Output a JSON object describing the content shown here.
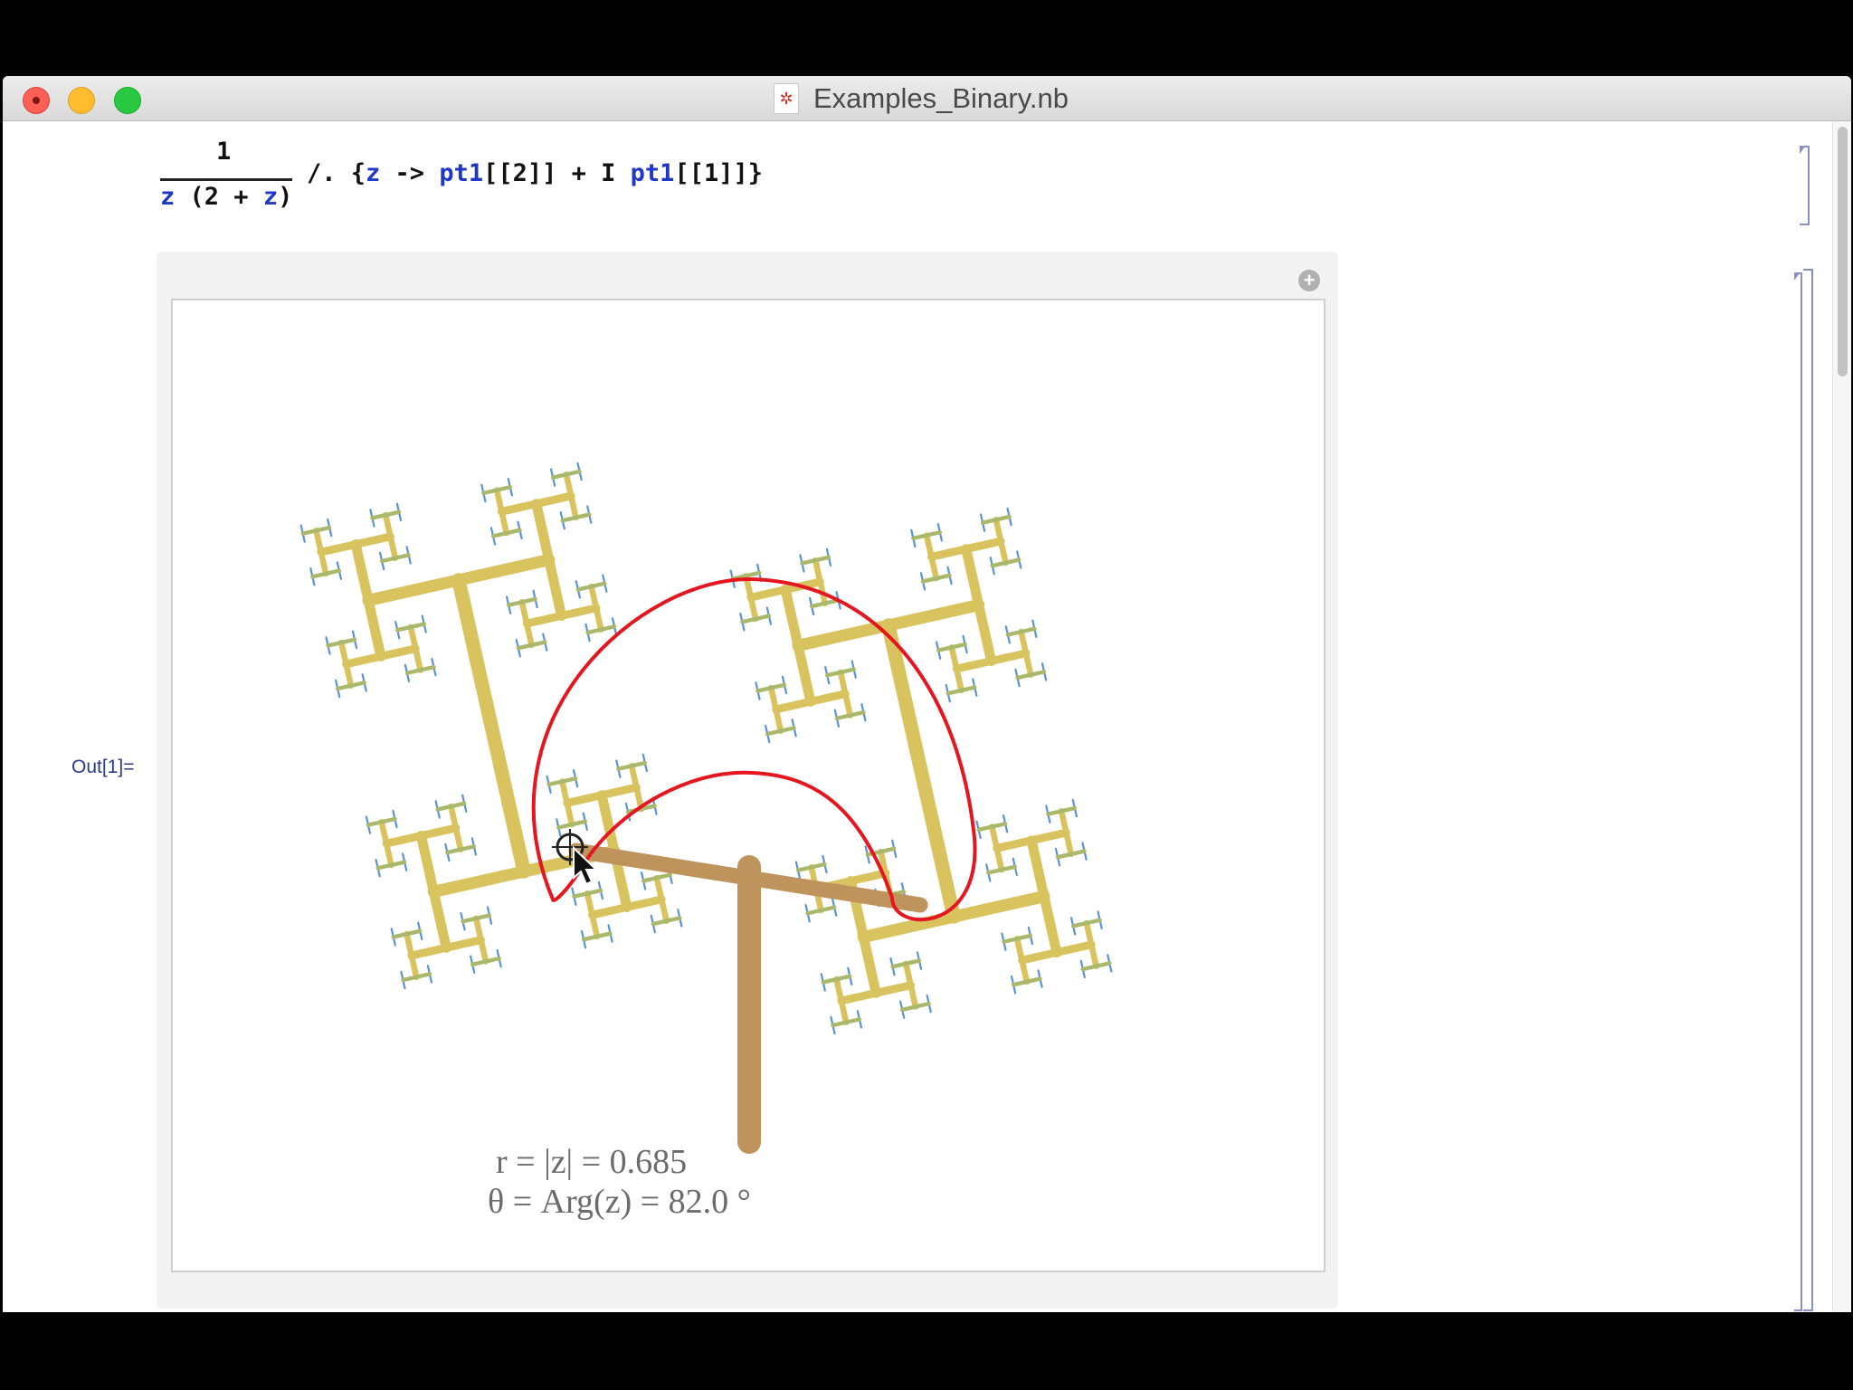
{
  "window": {
    "title": "Examples_Binary.nb",
    "file_icon": "mathematica-notebook-icon"
  },
  "input": {
    "numerator": "1",
    "den_z1": "z",
    "den_open": " (",
    "den_two": "2",
    "den_plus": " + ",
    "den_z2": "z",
    "den_close": ")",
    "op": "/. {",
    "rule_z": "z",
    "arrow": " -> ",
    "pt_a": "pt1",
    "idx_a": "[[2]]",
    "plus_i": " + I ",
    "pt_b": "pt1",
    "idx_b": "[[1]]}"
  },
  "output": {
    "label": "Out[1]=",
    "readout_r": "r = |z| = 0.685",
    "readout_theta": "θ = Arg(z) = 82.0 °"
  },
  "colors": {
    "curve": "#e4161f",
    "trunk": "#bf935c",
    "branch": "#d8c35e",
    "leaf": "#5b93d6",
    "text": "#6b6b6b"
  }
}
